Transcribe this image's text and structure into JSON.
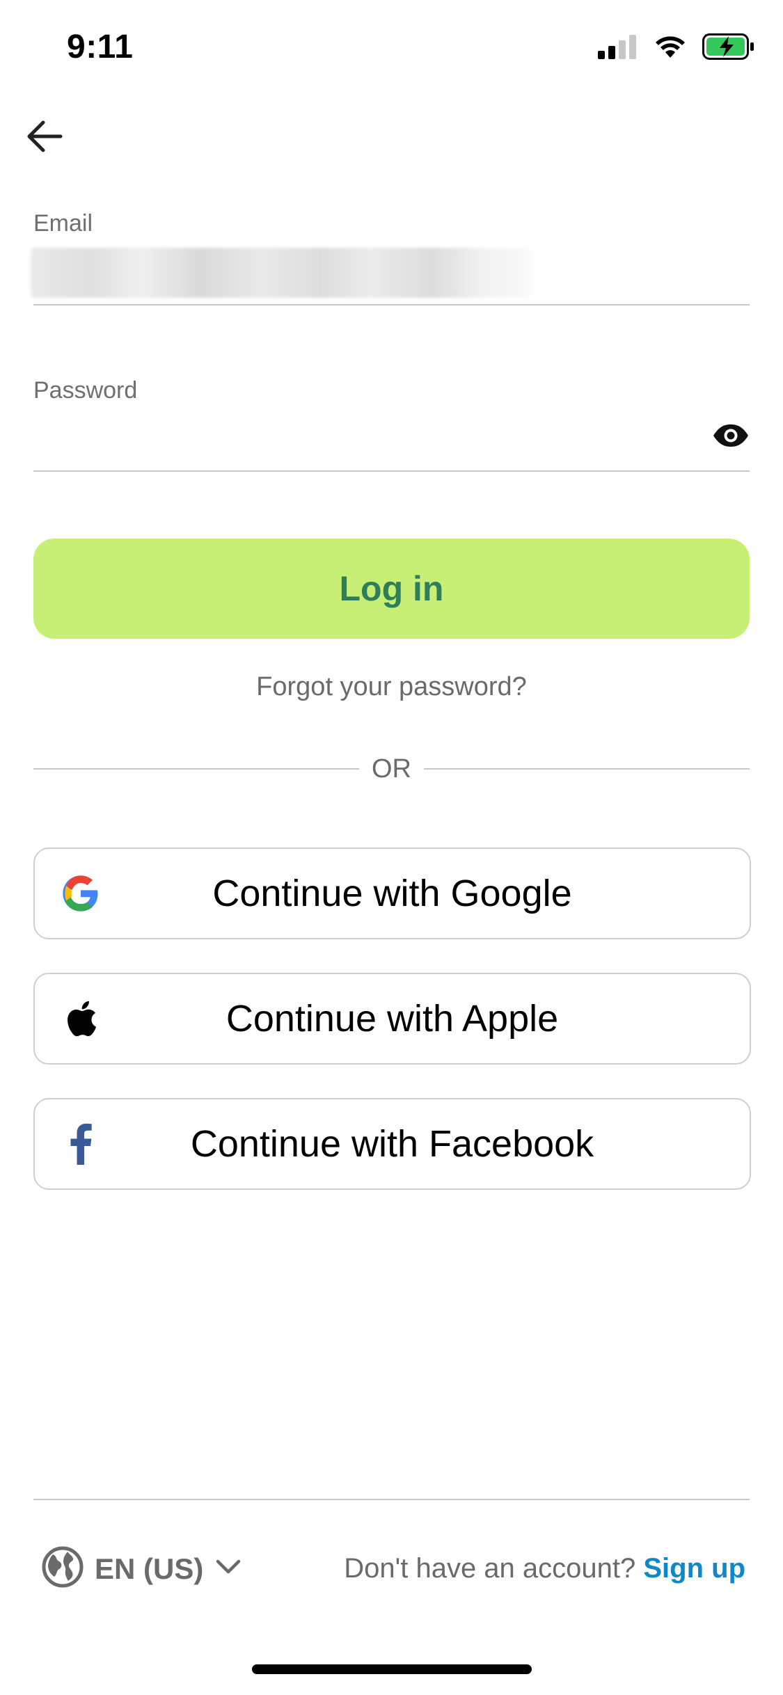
{
  "status_bar": {
    "time": "9:11"
  },
  "form": {
    "email_label": "Email",
    "email_value": "",
    "password_label": "Password",
    "password_value": ""
  },
  "actions": {
    "login_label": "Log in",
    "forgot_label": "Forgot your password?",
    "or_label": "OR"
  },
  "social": {
    "google_label": "Continue with Google",
    "apple_label": "Continue with Apple",
    "facebook_label": "Continue with Facebook"
  },
  "footer": {
    "language": "EN (US)",
    "no_account_text": "Don't have an account?",
    "signup_label": "Sign up"
  },
  "colors": {
    "accent_green": "#c8ef75",
    "login_text": "#2e7d5b",
    "link_blue": "#1187c9",
    "battery_green": "#34c759",
    "facebook_blue": "#3b5998"
  }
}
